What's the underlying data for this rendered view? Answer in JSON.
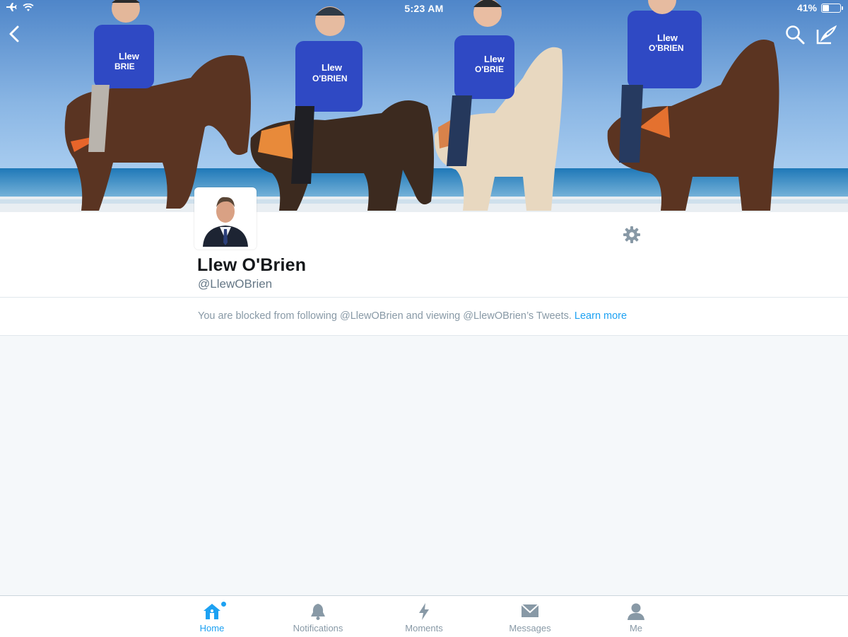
{
  "status_bar": {
    "time": "5:23 AM",
    "battery": "41%",
    "battery_level": 0.41
  },
  "header": {
    "icons": [
      "back-arrow-icon",
      "search-icon",
      "compose-icon"
    ]
  },
  "profile": {
    "display_name": "Llew O'Brien",
    "handle": "@LlewOBrien"
  },
  "blocked_notice": {
    "message": "You are blocked from following @LlewOBrien and viewing @LlewOBrien’s Tweets.",
    "link": "Learn more"
  },
  "tabs": [
    {
      "label": "Home",
      "icon": "home-icon",
      "active": true
    },
    {
      "label": "Notifications",
      "icon": "bell-icon",
      "active": false
    },
    {
      "label": "Moments",
      "icon": "lightning-icon",
      "active": false
    },
    {
      "label": "Messages",
      "icon": "envelope-icon",
      "active": false
    },
    {
      "label": "Me",
      "icon": "person-icon",
      "active": false
    }
  ],
  "colors": {
    "accent": "#1da1f2",
    "muted": "#8899a6",
    "background": "#f5f8fa"
  }
}
